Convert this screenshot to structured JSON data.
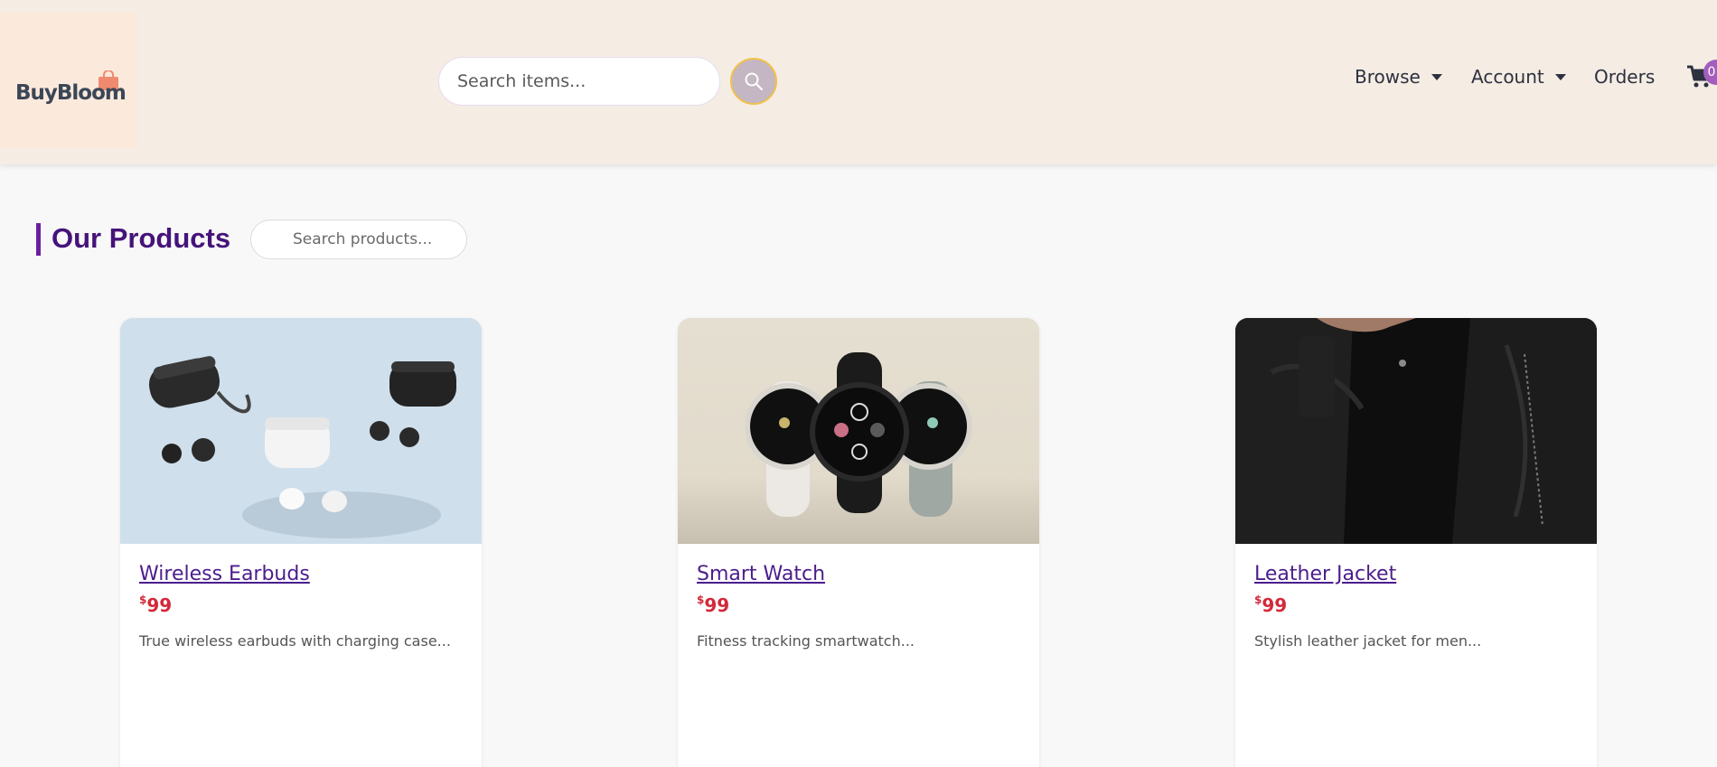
{
  "header": {
    "logo_text": "BuyBloom",
    "search_placeholder": "Search items...",
    "nav": {
      "browse": "Browse",
      "account": "Account",
      "orders": "Orders"
    },
    "cart_count": "0"
  },
  "products_section": {
    "title": "Our Products",
    "search_placeholder": "Search products..."
  },
  "products": [
    {
      "name": "Wireless Earbuds",
      "currency": "$",
      "price": "99",
      "description": "True wireless earbuds with charging case..."
    },
    {
      "name": "Smart Watch",
      "currency": "$",
      "price": "99",
      "description": "Fitness tracking smartwatch..."
    },
    {
      "name": "Leather Jacket",
      "currency": "$",
      "price": "99",
      "description": "Stylish leather jacket for men..."
    }
  ],
  "colors": {
    "header_bg": "#f5ece3",
    "accent_purple": "#6b1fa0",
    "price_red": "#d3293a",
    "badge_purple": "#a35dbe"
  },
  "icons": [
    "shopping-bag-icon",
    "search-icon",
    "caret-down-icon",
    "cart-icon"
  ]
}
